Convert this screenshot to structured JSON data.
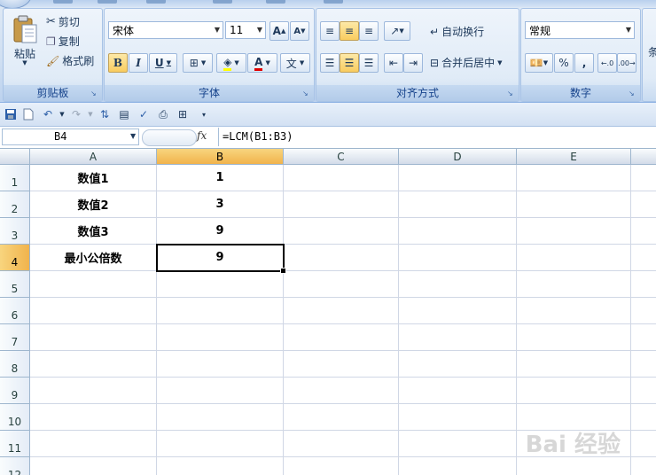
{
  "clipboard": {
    "paste_label": "粘贴",
    "cut_label": "剪切",
    "copy_label": "复制",
    "format_painter_label": "格式刷",
    "group_title": "剪贴板"
  },
  "font": {
    "font_name": "宋体",
    "font_size": "11",
    "grow_label": "A",
    "shrink_label": "A",
    "bold_label": "B",
    "italic_label": "I",
    "underline_label": "U",
    "font_color_label": "A",
    "phonetic_label": "文",
    "group_title": "字体"
  },
  "alignment": {
    "wrap_text_label": "自动换行",
    "merge_center_label": "合并后居中",
    "group_title": "对齐方式"
  },
  "number": {
    "format_value": "常规",
    "percent_label": "%",
    "comma_label": ",",
    "group_title": "数字"
  },
  "formula_bar": {
    "name_box": "B4",
    "fx_label": "fx",
    "formula": "=LCM(B1:B3)"
  },
  "sheet": {
    "columns": [
      "A",
      "B",
      "C",
      "D",
      "E"
    ],
    "rows": [
      "1",
      "2",
      "3",
      "4",
      "5",
      "6",
      "7",
      "8",
      "9",
      "10",
      "11",
      "12"
    ],
    "cells": {
      "A1": "数值1",
      "A2": "数值2",
      "A3": "数值3",
      "A4": "最小公倍数",
      "B1": "1",
      "B2": "3",
      "B3": "9",
      "B4": "9"
    },
    "selected_cell": "B4",
    "selected_column": "B",
    "selected_row": "4"
  },
  "watermark": "Bai 经验",
  "colors": {
    "ribbon_blue": "#cfdff2",
    "selection_orange": "#f1b34c",
    "gridline": "#d0d7e5"
  }
}
